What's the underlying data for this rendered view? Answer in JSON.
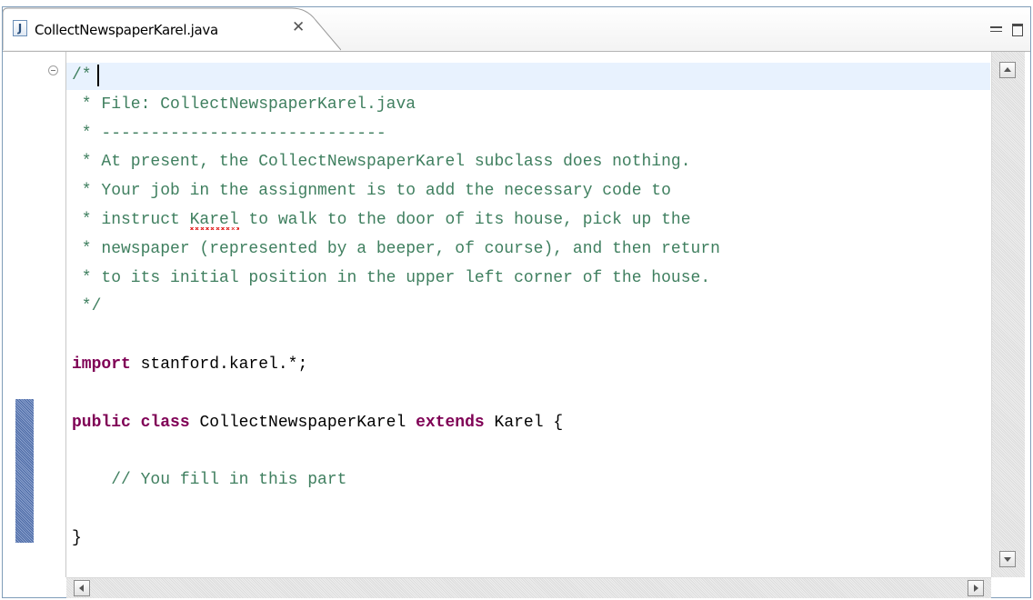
{
  "tab": {
    "title": "CollectNewspaperKarel.java",
    "file_icon_glyph": "J",
    "file_icon": "java-file-icon",
    "close_glyph": "✕",
    "close_icon": "close-icon"
  },
  "window_controls": {
    "minimize_icon": "minimize-icon",
    "maximize_icon": "maximize-icon"
  },
  "editor": {
    "language": "Java",
    "colors": {
      "comment": "#3f7f5f",
      "keyword": "#7f0055",
      "current_line": "#e8f2fe",
      "change_marker": "#6b86b8"
    },
    "lines": [
      {
        "kind": "comment",
        "text": "/*"
      },
      {
        "kind": "comment",
        "text": " * File: CollectNewspaperKarel.java"
      },
      {
        "kind": "comment",
        "text": " * -----------------------------"
      },
      {
        "kind": "comment",
        "text": " * At present, the CollectNewspaperKarel subclass does nothing."
      },
      {
        "kind": "comment",
        "text": " * Your job in the assignment is to add the necessary code to"
      },
      {
        "kind": "comment_squiggle",
        "before": " * instruct ",
        "word": "Karel",
        "after": " to walk to the door of its house, pick up the"
      },
      {
        "kind": "comment",
        "text": " * newspaper (represented by a beeper, of course), and then return"
      },
      {
        "kind": "comment",
        "text": " * to its initial position in the upper left corner of the house."
      },
      {
        "kind": "comment",
        "text": " */"
      },
      {
        "kind": "blank",
        "text": ""
      },
      {
        "kind": "import",
        "keyword": "import",
        "rest": " stanford.karel.*;"
      },
      {
        "kind": "blank",
        "text": ""
      },
      {
        "kind": "class",
        "kw1": "public",
        "kw2": "class",
        "name": " CollectNewspaperKarel ",
        "kw3": "extends",
        "rest": " Karel {"
      },
      {
        "kind": "blank",
        "text": ""
      },
      {
        "kind": "comment",
        "text": "    // You fill in this part"
      },
      {
        "kind": "blank",
        "text": ""
      },
      {
        "kind": "plain",
        "text": "}"
      }
    ]
  }
}
